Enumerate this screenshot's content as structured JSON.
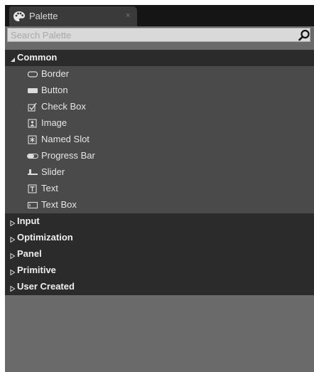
{
  "tab": {
    "title": "Palette",
    "close_glyph": "×",
    "icon": "palette-icon"
  },
  "search": {
    "placeholder": "Search Palette",
    "value": "",
    "icon": "search-icon"
  },
  "categories": [
    {
      "label": "Common",
      "expanded": true,
      "items": [
        {
          "label": "Border",
          "icon": "border-icon"
        },
        {
          "label": "Button",
          "icon": "button-icon"
        },
        {
          "label": "Check Box",
          "icon": "checkbox-icon"
        },
        {
          "label": "Image",
          "icon": "image-icon"
        },
        {
          "label": "Named Slot",
          "icon": "named-slot-icon"
        },
        {
          "label": "Progress Bar",
          "icon": "progress-bar-icon"
        },
        {
          "label": "Slider",
          "icon": "slider-icon"
        },
        {
          "label": "Text",
          "icon": "text-icon"
        },
        {
          "label": "Text Box",
          "icon": "text-box-icon"
        }
      ]
    },
    {
      "label": "Input",
      "expanded": false
    },
    {
      "label": "Optimization",
      "expanded": false
    },
    {
      "label": "Panel",
      "expanded": false
    },
    {
      "label": "Primitive",
      "expanded": false
    },
    {
      "label": "User Created",
      "expanded": false
    }
  ],
  "colors": {
    "tab_bar": "#151515",
    "tab": "#3a3a3a",
    "panel_bg": "#6a6a6a",
    "category_bg": "#2b2b2b",
    "items_bg": "#4a4a4a",
    "text": "#e6e6e6"
  }
}
